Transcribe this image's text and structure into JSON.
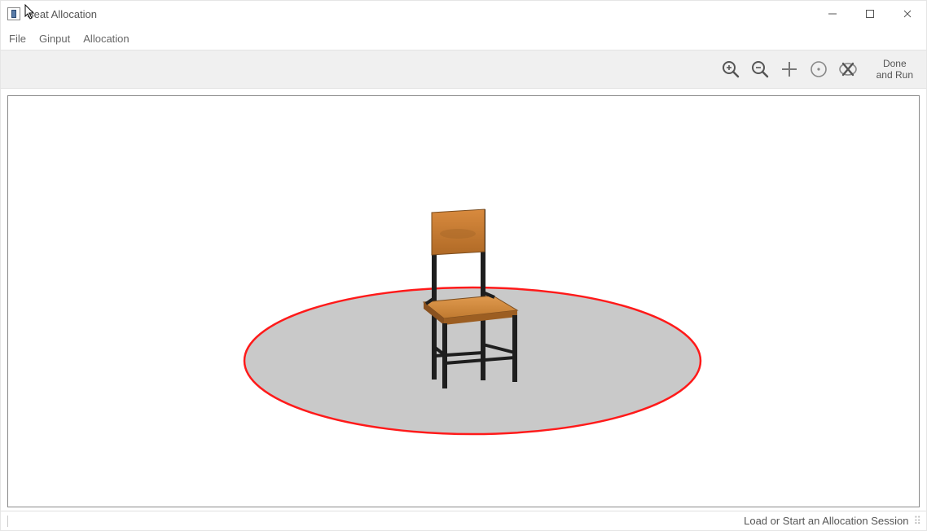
{
  "window": {
    "title": "Seat Allocation"
  },
  "menu": {
    "file": "File",
    "ginput": "Ginput",
    "allocation": "Allocation"
  },
  "toolbar": {
    "done_line1": "Done",
    "done_line2": "and Run"
  },
  "status": {
    "message": "Load or Start an Allocation Session"
  },
  "icons": {
    "zoom_in": "zoom-in-icon",
    "zoom_out": "zoom-out-icon",
    "add": "plus-icon",
    "center": "center-dot-icon",
    "delete": "delete-x-icon"
  }
}
